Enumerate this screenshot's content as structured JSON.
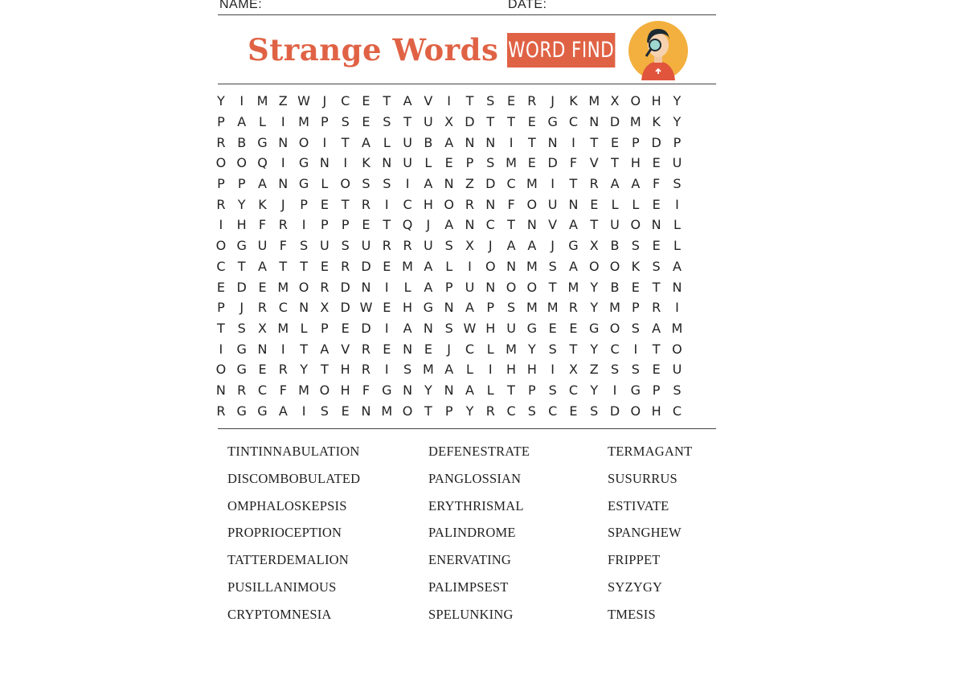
{
  "header": {
    "name_label": "NAME:",
    "date_label": "DATE:"
  },
  "title": {
    "main": "Strange Words",
    "badge": "WORD FIND"
  },
  "colors": {
    "accent": "#e06245",
    "avatar_bg": "#f3b03e",
    "text": "#222222"
  },
  "grid_rows": [
    "YIMZWJCETAVITSERJKMXOHY",
    "PALIMPSESTUXDTTEGCNDMKY",
    "RBGNOITALUBANNITNITEPDP",
    "OOQIGNIKNULEPSMEDFVTHEU",
    "PPANGLOSSIANZDCMITRAAFS",
    "RYKJPETRICHORNFOUNELLEI",
    "IHFRIPPETQJANCTNVATUONL",
    "OGUFSUSURRUSXJAAJGXBSEL",
    "CTATTERDEMALIONMSAOOKSA",
    "EDEMORDNILAPUNOOTMYBETN",
    "PJRCNXDWEHGNAPSMMRYMPRI",
    "TSXMLPEDIANSWHUGEEGOSAM",
    "IGNITAVRENEJCLMYSTYCITO",
    "OGERYTHRISMALIHHIXZSSEU",
    "NRCFMOHFGNYNALTPSCYIGPS",
    "RGGAISENMOTPYRCSCESDOHC"
  ],
  "word_list": {
    "col1": [
      "TINTINNABULATION",
      "DISCOMBOBULATED",
      "OMPHALOSKEPSIS",
      "PROPRIOCEPTION",
      "TATTERDEMALION",
      "PUSILLANIMOUS",
      "CRYPTOMNESIA"
    ],
    "col2": [
      "DEFENESTRATE",
      "PANGLOSSIAN",
      "ERYTHRISMAL",
      "PALINDROME",
      "ENERVATING",
      "PALIMPSEST",
      "SPELUNKING"
    ],
    "col3": [
      "TERMAGANT",
      "SUSURRUS",
      "ESTIVATE",
      "SPANGHEW",
      "FRIPPET",
      "SYZYGY",
      "TMESIS"
    ]
  },
  "avatar_icon": "detective-avatar-icon"
}
